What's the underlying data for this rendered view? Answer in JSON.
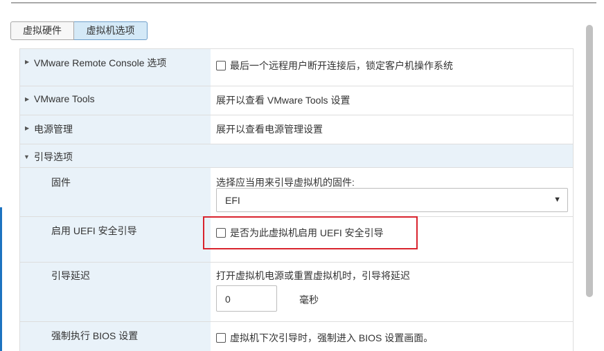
{
  "tabs": [
    {
      "label": "虚拟硬件",
      "active": false
    },
    {
      "label": "虚拟机选项",
      "active": true
    }
  ],
  "rows": {
    "vmrc": {
      "label": "VMware Remote Console 选项",
      "checkbox_label": "最后一个远程用户断开连接后，锁定客户机操作系统",
      "checked": false
    },
    "tools": {
      "label": "VMware Tools",
      "value": "展开以查看 VMware Tools 设置"
    },
    "power": {
      "label": "电源管理",
      "value": "展开以查看电源管理设置"
    },
    "boot": {
      "label": "引导选项",
      "expanded": true
    },
    "firmware": {
      "label": "固件",
      "description": "选择应当用来引导虚拟机的固件:",
      "selected": "EFI"
    },
    "secure_boot": {
      "label": "启用 UEFI 安全引导",
      "checkbox_label": "是否为此虚拟机启用 UEFI 安全引导",
      "checked": false
    },
    "boot_delay": {
      "label": "引导延迟",
      "description": "打开虚拟机电源或重置虚拟机时，引导将延迟",
      "value": "0",
      "unit": "毫秒"
    },
    "force_bios": {
      "label": "强制执行 BIOS 设置",
      "checkbox_label": "虚拟机下次引导时，强制进入 BIOS 设置画面。",
      "checked": false
    }
  },
  "colors": {
    "label_bg": "#e9f2f9",
    "active_tab_bg": "#d4e9f7",
    "highlight": "#d9232d"
  }
}
